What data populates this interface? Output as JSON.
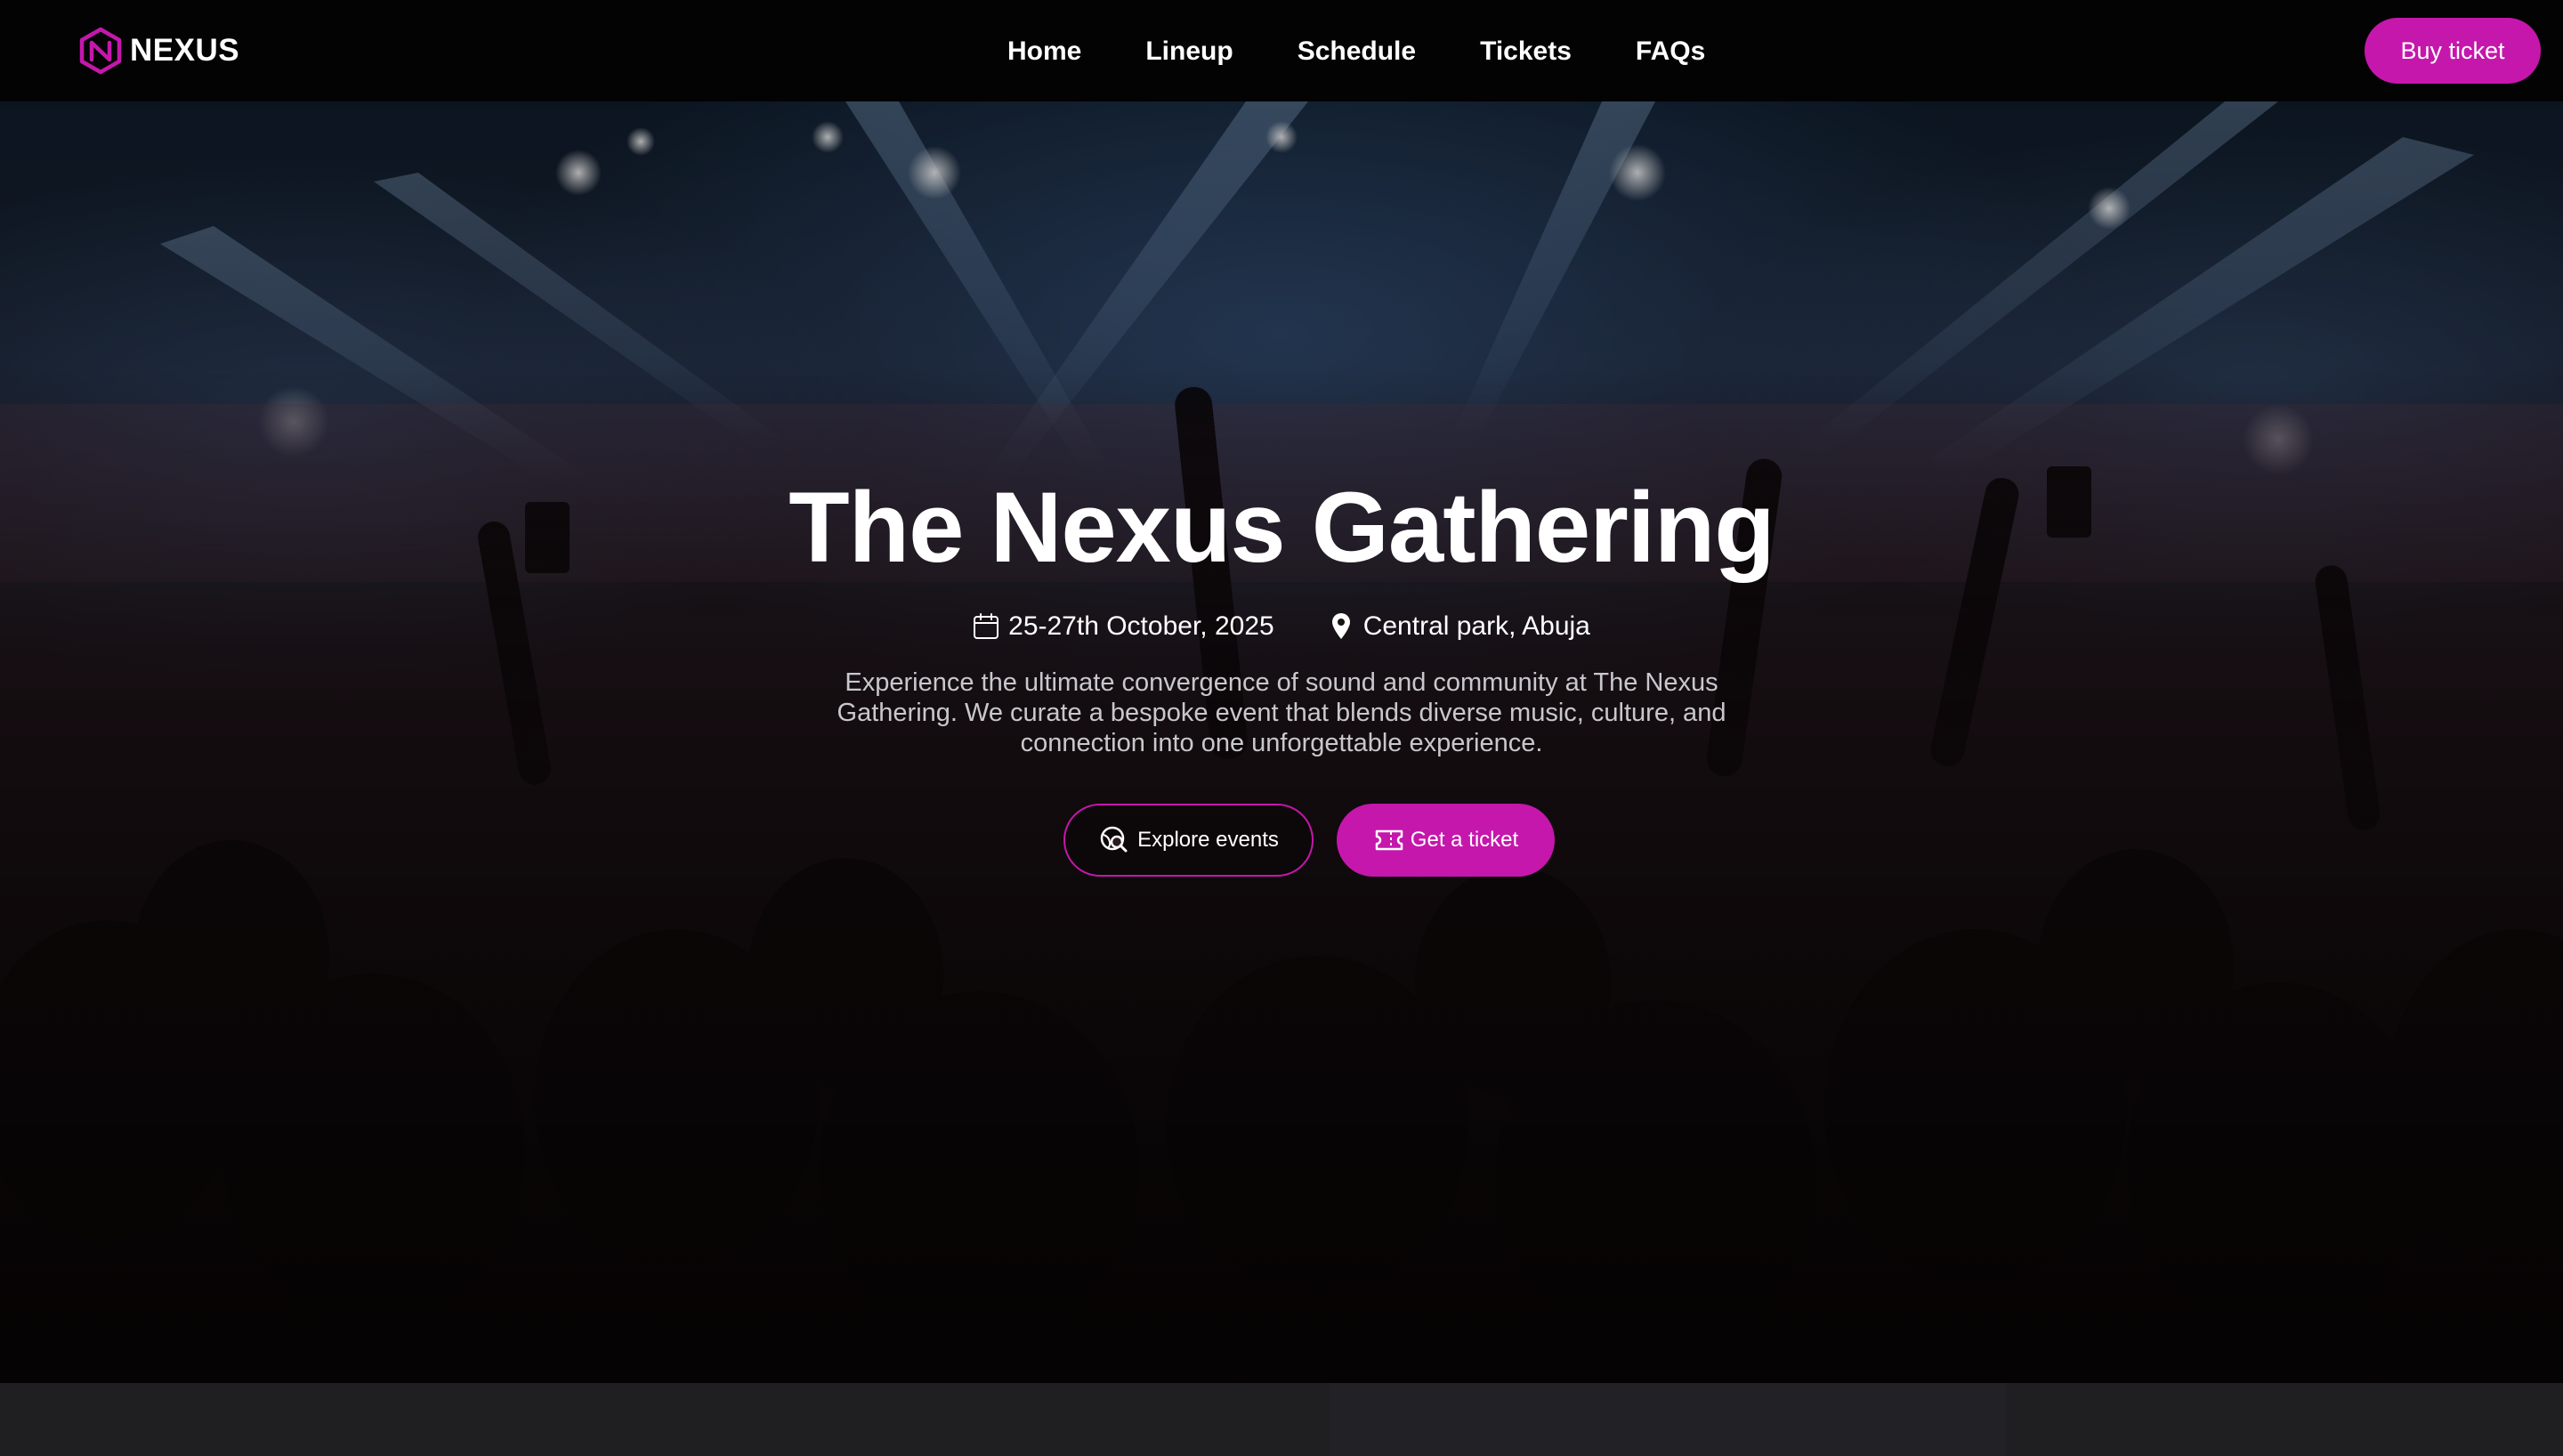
{
  "brand": {
    "name": "NEXUS",
    "logo_icon": "hexagon-n-logo-icon",
    "accent_color": "#c517ac"
  },
  "nav": {
    "links": [
      {
        "label": "Home"
      },
      {
        "label": "Lineup"
      },
      {
        "label": "Schedule"
      },
      {
        "label": "Tickets"
      },
      {
        "label": "FAQs"
      }
    ],
    "cta_label": "Buy ticket"
  },
  "hero": {
    "title": "The Nexus Gathering",
    "date": "25-27th October, 2025",
    "date_icon": "calendar-icon",
    "location": "Central park, Abuja",
    "location_icon": "map-pin-icon",
    "description": "Experience the ultimate convergence of sound and community at The Nexus Gathering. We curate a bespoke event that blends diverse music, culture, and connection into one unforgettable experience.",
    "buttons": {
      "explore_label": "Explore events",
      "explore_icon": "search-globe-icon",
      "ticket_label": "Get a ticket",
      "ticket_icon": "ticket-icon"
    },
    "background": "concert-crowd-stage-lights-photo"
  }
}
